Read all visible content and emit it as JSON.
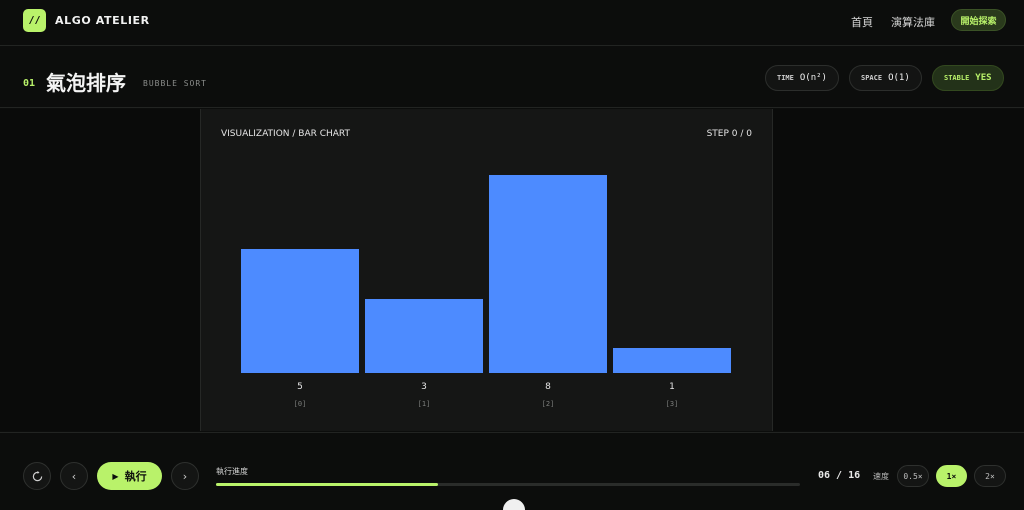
{
  "header": {
    "logo_glyph": "//",
    "brand": "ALGO ATELIER",
    "nav": [
      {
        "label": "首頁"
      },
      {
        "label": "演算法庫"
      }
    ],
    "cta_label": "開始探索"
  },
  "algorithm": {
    "number": "01",
    "title": "氣泡排序",
    "subtitle": "BUBBLE SORT",
    "badges": [
      {
        "key": "TIME",
        "value": "O(n²)"
      },
      {
        "key": "SPACE",
        "value": "O(1)"
      },
      {
        "key": "STABLE",
        "value": "YES"
      }
    ]
  },
  "visualization": {
    "label": "VISUALIZATION / BAR CHART",
    "step": "STEP 0 / 0"
  },
  "chart_data": {
    "type": "bar",
    "categories": [
      "[0]",
      "[1]",
      "[2]",
      "[3]"
    ],
    "values": [
      5,
      3,
      8,
      1
    ],
    "ylim": [
      0,
      8
    ],
    "bar_color": "#4d8bff",
    "grid": false
  },
  "controls": {
    "reset_icon": "reset-icon",
    "prev_icon": "chevron-left-icon",
    "run_label": "執行",
    "next_icon": "chevron-right-icon",
    "progress_label": "執行進度",
    "progress": 0.38,
    "counter": "06 / 16",
    "speed_label": "速度",
    "speeds": [
      "0.5×",
      "1×",
      "2×"
    ],
    "selected_speed": "1×",
    "accent": "#b9f26a"
  }
}
